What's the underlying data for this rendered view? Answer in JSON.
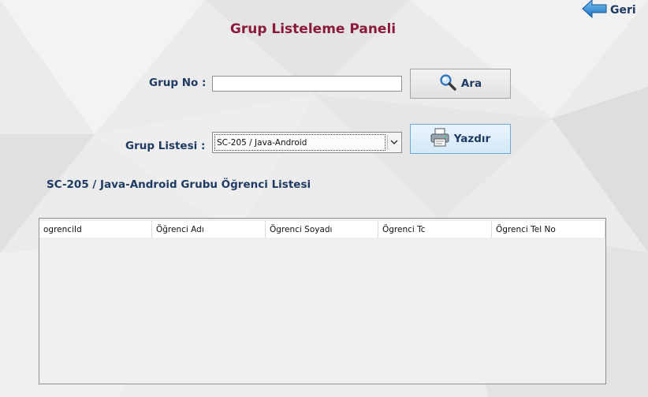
{
  "nav": {
    "back_label": "Geri",
    "back_icon": "arrow-left-icon"
  },
  "panel": {
    "title": "Grup Listeleme Paneli"
  },
  "form": {
    "group_no_label": "Grup No :",
    "group_no_value": "",
    "search_label": "Ara",
    "search_icon": "magnifier-icon",
    "group_list_label": "Grup Listesi :",
    "group_list_selected": "SC-205 / Java-Android",
    "print_label": "Yazdır",
    "print_icon": "printer-icon"
  },
  "student_list": {
    "title": "SC-205 / Java-Android Grubu Öğrenci Listesi",
    "columns": [
      "ogrenciId",
      "Öğrenci Adı",
      "Ögrenci Soyadı",
      "Ögrenci Tc",
      "Ögrenci Tel No"
    ],
    "rows": []
  },
  "colors": {
    "title": "#8b1a3a",
    "label": "#1f3b64",
    "print_button": "#d4e9f8"
  }
}
